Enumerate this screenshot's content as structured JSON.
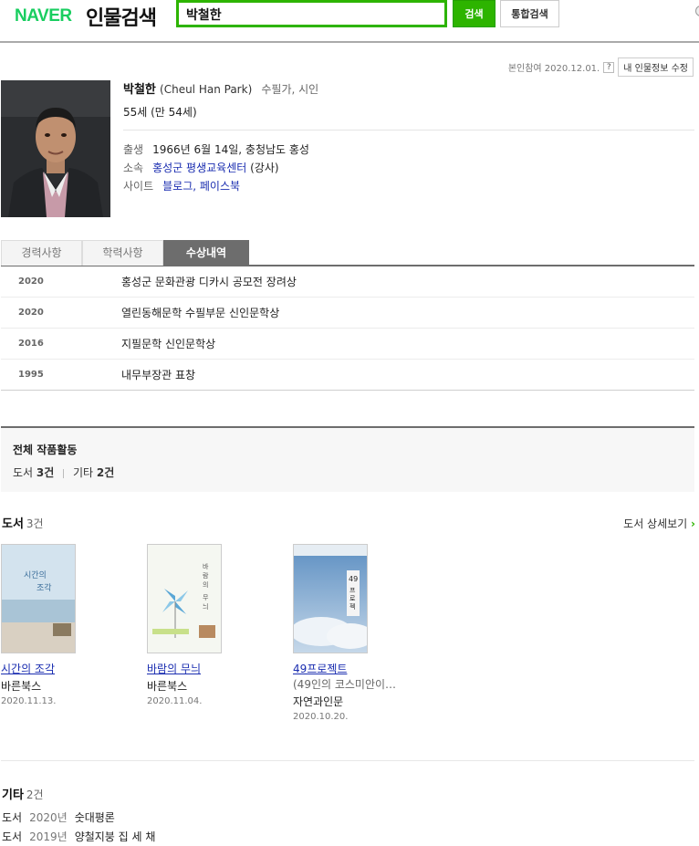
{
  "header": {
    "logo": "NAVER",
    "title": "인물검색",
    "search_value": "박철한",
    "search_button": "검색",
    "integrated_button": "통합검색"
  },
  "ref": {
    "text": "본인참여 2020.12.01.",
    "help": "?",
    "edit_button": "내 인물정보 수정"
  },
  "profile": {
    "name": "박철한",
    "name_en": "(Cheul Han Park)",
    "job": "수필가, 시인",
    "age": "55세 (만 54세)",
    "birth_label": "출생",
    "birth_value": "1966년 6월 14일, 충청남도 홍성",
    "affil_label": "소속",
    "affil_link": "홍성군 평생교육센터",
    "affil_extra": "(강사)",
    "site_label": "사이트",
    "site_value": "블로그, 페이스북"
  },
  "tabs": [
    "경력사항",
    "학력사항",
    "수상내역"
  ],
  "awards": [
    {
      "year": "2020",
      "text": "홍성군 문화관광 디카시 공모전 장려상"
    },
    {
      "year": "2020",
      "text": "열린동해문학 수필부문 신인문학상"
    },
    {
      "year": "2016",
      "text": "지필문학 신인문학상"
    },
    {
      "year": "1995",
      "text": "내무부장관 표창"
    }
  ],
  "total": {
    "title": "전체 작품활동",
    "books_label": "도서",
    "books_count": "3건",
    "etc_label": "기타",
    "etc_count": "2건"
  },
  "books_section": {
    "title": "도서",
    "count": "3건",
    "more": "도서 상세보기",
    "more_icon": "chevron-right-icon"
  },
  "books": [
    {
      "title": "시간의 조각",
      "subtitle": "",
      "publisher": "바른북스",
      "date": "2020.11.13.",
      "cover_text": "시간의 조각",
      "cover_color": "#cfe0ea"
    },
    {
      "title": "바람의 무늬",
      "subtitle": "",
      "publisher": "바른북스",
      "date": "2020.11.04.",
      "cover_text": "바람의 무늬",
      "cover_color": "#f2f5ee"
    },
    {
      "title": "49프로젝트",
      "subtitle": "(49인의 코스미안이…",
      "publisher": "자연과인문",
      "date": "2020.10.20.",
      "cover_text": "49 프로젝트",
      "cover_color": "#7fa6cc"
    }
  ],
  "etc_section": {
    "title": "기타",
    "count": "2건",
    "items": [
      {
        "kind": "도서",
        "year": "2020년",
        "title": "숫대평론"
      },
      {
        "kind": "도서",
        "year": "2019년",
        "title": "양철지붕 집 세 채"
      }
    ]
  }
}
